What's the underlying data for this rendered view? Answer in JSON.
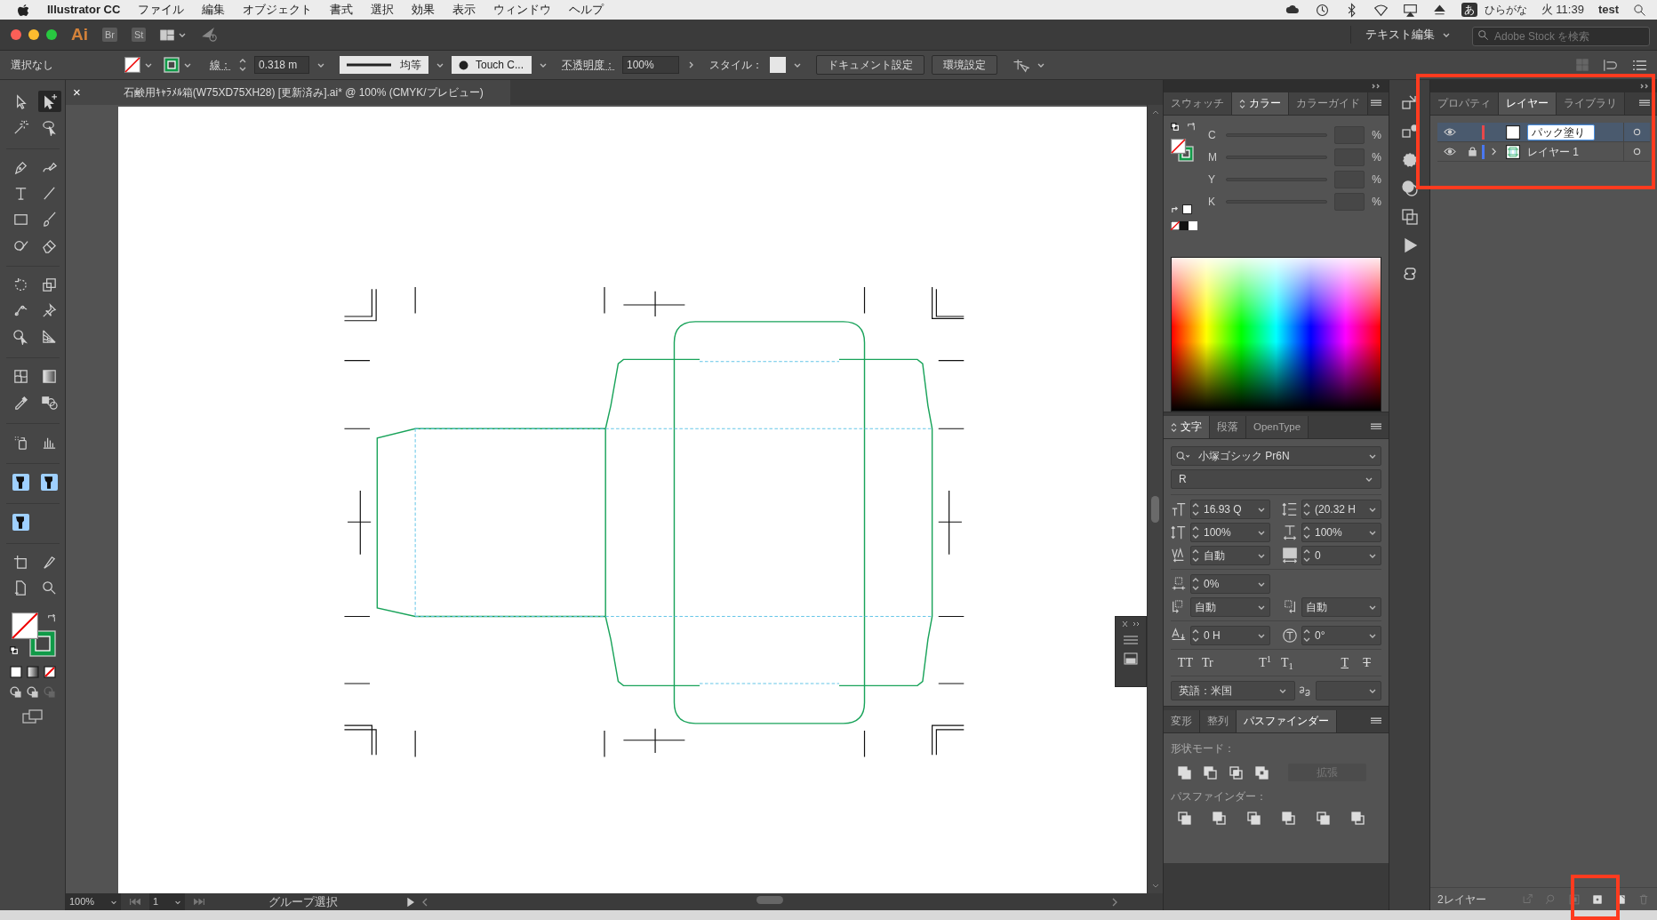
{
  "menu_bar": {
    "app_name": "Illustrator CC",
    "items": [
      "ファイル",
      "編集",
      "オブジェクト",
      "書式",
      "選択",
      "効果",
      "表示",
      "ウィンドウ",
      "ヘルプ"
    ],
    "input_badge": "あ",
    "input_mode": "ひらがな",
    "clock": "火 11:39",
    "user": "test"
  },
  "app_bar": {
    "logo": "Ai",
    "apps": [
      "Br",
      "St"
    ],
    "workspace": "テキスト編集",
    "search": {
      "placeholder": "Adobe Stock を検索"
    }
  },
  "control_bar": {
    "selection": "選択なし",
    "stroke_label": "線：",
    "stroke_weight": "0.318 m",
    "stroke_profile": "均等",
    "brush": "Touch C...",
    "opacity_label": "不透明度：",
    "opacity": "100%",
    "style_label": "スタイル：",
    "buttons": [
      "ドキュメント設定",
      "環境設定"
    ]
  },
  "toolbar": {
    "groups": [
      [
        [
          {
            "kind": "arrow",
            "selected": false
          },
          {
            "kind": "arrow-plus",
            "selected": true
          }
        ],
        [
          {
            "kind": "wand",
            "selected": false
          },
          {
            "kind": "lasso",
            "selected": false
          }
        ]
      ],
      [
        [
          {
            "kind": "pen",
            "selected": false
          },
          {
            "kind": "pen-curve",
            "selected": false
          }
        ],
        [
          {
            "kind": "type",
            "selected": false
          },
          {
            "kind": "line",
            "selected": false
          }
        ],
        [
          {
            "kind": "rectangle",
            "selected": false
          },
          {
            "kind": "brush",
            "selected": false
          }
        ],
        [
          {
            "kind": "shaper",
            "selected": false
          },
          {
            "kind": "eraser",
            "selected": false
          }
        ]
      ],
      [
        [
          {
            "kind": "rotate",
            "selected": false
          },
          {
            "kind": "scale",
            "selected": false
          }
        ],
        [
          {
            "kind": "puppet",
            "selected": false
          },
          {
            "kind": "pin",
            "selected": false
          }
        ],
        [
          {
            "kind": "shape-builder",
            "selected": false
          },
          {
            "kind": "perspective",
            "selected": false
          }
        ]
      ],
      [
        [
          {
            "kind": "mesh",
            "selected": false
          },
          {
            "kind": "gradient",
            "selected": false
          }
        ],
        [
          {
            "kind": "eyedropper",
            "selected": false
          },
          {
            "kind": "blend",
            "selected": false
          }
        ]
      ],
      [
        [
          {
            "kind": "spray",
            "selected": false
          },
          {
            "kind": "graph",
            "selected": false
          }
        ]
      ],
      [
        [
          {
            "kind": "plugin",
            "selected": false
          },
          {
            "kind": "plugin",
            "selected": false
          }
        ]
      ],
      [
        [
          {
            "kind": "plugin",
            "selected": false
          }
        ]
      ],
      [
        [
          {
            "kind": "artboard",
            "selected": false
          },
          {
            "kind": "knife",
            "selected": false
          }
        ],
        [
          {
            "kind": "page",
            "selected": false
          },
          {
            "kind": "zoom",
            "selected": false
          }
        ]
      ]
    ]
  },
  "document_tab": {
    "close": "×",
    "title": "石鹸用ｷｬﾗﾒﾙ箱(W75XD75XH28) [更新済み].ai* @ 100% (CMYK/プレビュー)"
  },
  "status_bar": {
    "zoom": "100%",
    "artboard": "1",
    "tool": "グループ選択"
  },
  "color_panel": {
    "tabs": [
      {
        "label": "スウォッチ",
        "selected": false
      },
      {
        "label": "カラー",
        "selected": true
      },
      {
        "label": "カラーガイド",
        "selected": false
      }
    ],
    "channels": [
      {
        "name": "C",
        "unit": "%"
      },
      {
        "name": "M",
        "unit": "%"
      },
      {
        "name": "Y",
        "unit": "%"
      },
      {
        "name": "K",
        "unit": "%"
      }
    ]
  },
  "character_panel": {
    "tabs": [
      {
        "label": "文字",
        "selected": true
      },
      {
        "label": "段落",
        "selected": false
      },
      {
        "label": "OpenType",
        "selected": false
      }
    ],
    "font_family": "小塚ゴシック Pr6N",
    "font_style": "R",
    "font_size": "16.93 Q",
    "leading": "(20.32 H",
    "vertical_scale": "100%",
    "horizontal_scale": "100%",
    "kerning": "自動",
    "tracking": "0",
    "tsume": "0%",
    "aki_left": "自動",
    "aki_right": "自動",
    "baseline_shift": "0 H",
    "rotation": "0°",
    "style_buttons": [
      {
        "kind": "all-caps",
        "glyph": "TT"
      },
      {
        "kind": "small-caps",
        "glyph": "Tr"
      },
      {
        "kind": "superscript",
        "glyph": "T$^{1}$"
      },
      {
        "kind": "subscript",
        "glyph": "T$_{1}$"
      },
      {
        "kind": "underline",
        "glyph": "T"
      },
      {
        "kind": "strikethrough",
        "glyph": "T"
      }
    ],
    "language": "英語：米国"
  },
  "pathfinder_panel": {
    "tabs": [
      {
        "label": "変形",
        "selected": false
      },
      {
        "label": "整列",
        "selected": false
      },
      {
        "label": "パスファインダー",
        "selected": true
      }
    ],
    "shape_modes_label": "形状モード：",
    "expand_button": {
      "label": "拡張",
      "disabled": true
    },
    "pathfinders_label": "パスファインダー："
  },
  "layers_panel": {
    "tabs": [
      {
        "label": "プロパティ",
        "selected": false
      },
      {
        "label": "レイヤー",
        "selected": true
      },
      {
        "label": "ライブラリ",
        "selected": false
      }
    ],
    "layers": [
      {
        "name": "パック塗り",
        "color": "#e8484a",
        "selected": true,
        "editing": true,
        "visible": true,
        "locked": false,
        "expandable": false,
        "kind": "empty"
      },
      {
        "name": "レイヤー 1",
        "color": "#4a78f0",
        "selected": false,
        "editing": false,
        "visible": true,
        "locked": true,
        "expandable": true,
        "kind": "artwork"
      }
    ],
    "layer_count": "2レイヤー"
  }
}
